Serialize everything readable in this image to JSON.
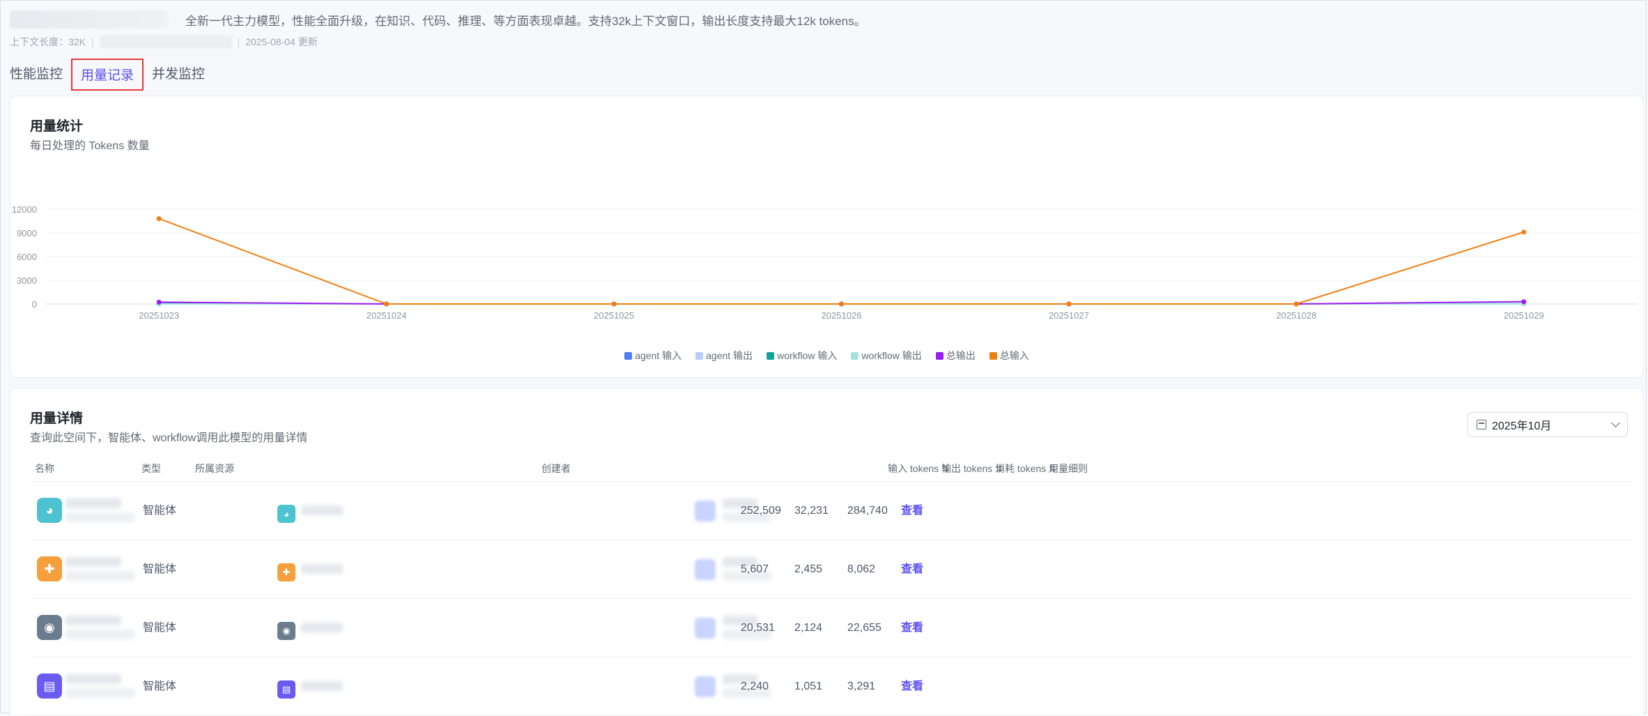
{
  "header": {
    "description": "全新一代主力模型，性能全面升级，在知识、代码、推理、等方面表现卓越。支持32k上下文窗口，输出长度支持最大12k tokens。",
    "context_label": "上下文长度：32K",
    "updated": "2025-08-04 更新"
  },
  "tabs": [
    {
      "label": "性能监控",
      "active": false
    },
    {
      "label": "用量记录",
      "active": true
    },
    {
      "label": "并发监控",
      "active": false
    }
  ],
  "stats_card": {
    "title": "用量统计",
    "subtitle": "每日处理的 Tokens 数量"
  },
  "chart_data": {
    "type": "line",
    "x": [
      "20251023",
      "20251024",
      "20251025",
      "20251026",
      "20251027",
      "20251028",
      "20251029"
    ],
    "ylim": [
      0,
      12000
    ],
    "yticks": [
      0,
      3000,
      6000,
      9000,
      12000
    ],
    "grid": true,
    "legend_position": "bottom",
    "series": [
      {
        "name": "agent 输入",
        "color": "#4e7df1",
        "values": [
          0,
          0,
          0,
          0,
          0,
          0,
          0
        ]
      },
      {
        "name": "agent 输出",
        "color": "#b9cdfa",
        "values": [
          0,
          0,
          0,
          0,
          0,
          0,
          0
        ]
      },
      {
        "name": "workflow 输入",
        "color": "#14a39a",
        "values": [
          60,
          0,
          0,
          0,
          0,
          0,
          20
        ]
      },
      {
        "name": "workflow 输出",
        "color": "#a5e3de",
        "values": [
          0,
          0,
          0,
          0,
          0,
          0,
          0
        ]
      },
      {
        "name": "总输出",
        "color": "#9b1cf0",
        "values": [
          230,
          0,
          0,
          0,
          0,
          0,
          290
        ]
      },
      {
        "name": "总输入",
        "color": "#f07f13",
        "values": [
          10800,
          0,
          0,
          0,
          0,
          0,
          9100
        ]
      }
    ]
  },
  "details_card": {
    "title": "用量详情",
    "subtitle": "查询此空间下，智能体、workflow调用此模型的用量详情",
    "month_select": "2025年10月"
  },
  "table": {
    "columns": {
      "name": "名称",
      "type": "类型",
      "resource": "所属资源",
      "creator": "创建者",
      "input": "输入 tokens",
      "output": "输出 tokens",
      "total": "消耗 tokens",
      "detail": "用量细则"
    },
    "sort_icon": "⇅",
    "rows": [
      {
        "type": "智能体",
        "input": "252,509",
        "output": "32,231",
        "total": "284,740",
        "action": "查看",
        "icon_color": "#4cc3cf",
        "icon": "robot-face-icon"
      },
      {
        "type": "智能体",
        "input": "5,607",
        "output": "2,455",
        "total": "8,062",
        "action": "查看",
        "icon_color": "#f5a03c",
        "icon": "puzzle-icon"
      },
      {
        "type": "智能体",
        "input": "20,531",
        "output": "2,124",
        "total": "22,655",
        "action": "查看",
        "icon_color": "#6b7c8f",
        "icon": "robot-icon"
      },
      {
        "type": "智能体",
        "input": "2,240",
        "output": "1,051",
        "total": "3,291",
        "action": "查看",
        "icon_color": "#6a5cf0",
        "icon": "document-icon"
      }
    ]
  }
}
